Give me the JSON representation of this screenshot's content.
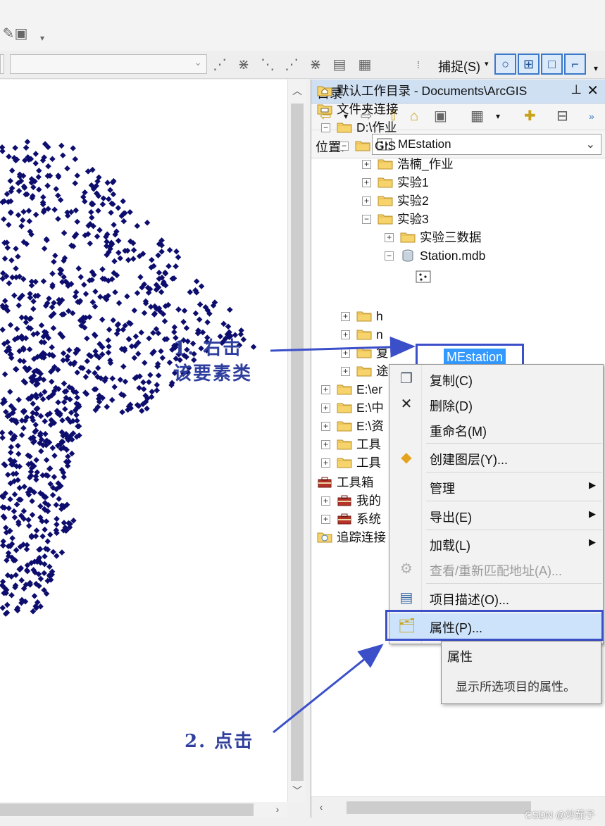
{
  "toolbar": {
    "snap_label": "捕捉(S)",
    "snap_buttons": [
      "point-snap",
      "vertex-snap",
      "edge-snap",
      "end-snap"
    ]
  },
  "catalog": {
    "title": "目录",
    "location_label": "位置:",
    "location_value": "MEstation",
    "tree": [
      {
        "label": "默认工作目录 - Documents\\ArcGIS",
        "icon": "home-folder-icon"
      },
      {
        "label": "文件夹连接",
        "icon": "folder-connections-icon"
      },
      {
        "label": "D:\\作业",
        "icon": "folder-icon"
      },
      {
        "label": "GIS",
        "icon": "folder-icon"
      },
      {
        "label": "浩楠_作业",
        "icon": "folder-icon"
      },
      {
        "label": "实验1",
        "icon": "folder-icon"
      },
      {
        "label": "实验2",
        "icon": "folder-icon"
      },
      {
        "label": "实验3",
        "icon": "folder-icon"
      },
      {
        "label": "实验三数据",
        "icon": "folder-icon"
      },
      {
        "label": "Station.mdb",
        "icon": "database-icon"
      },
      {
        "label": "MEstation",
        "icon": "point-feature-class-icon"
      },
      {
        "label": "h",
        "icon": "folder-icon"
      },
      {
        "label": "n",
        "icon": "folder-icon"
      },
      {
        "label": "复",
        "icon": "folder-icon"
      },
      {
        "label": "途",
        "icon": "folder-icon"
      },
      {
        "label": "E:\\er",
        "icon": "folder-icon"
      },
      {
        "label": "E:\\中",
        "icon": "folder-icon"
      },
      {
        "label": "E:\\资",
        "icon": "folder-icon"
      },
      {
        "label": "工具",
        "icon": "folder-icon"
      },
      {
        "label": "工具",
        "icon": "folder-icon"
      },
      {
        "label": "工具箱",
        "icon": "toolbox-icon"
      },
      {
        "label": "我的",
        "icon": "toolbox-icon"
      },
      {
        "label": "系统",
        "icon": "toolbox-icon"
      },
      {
        "label": "追踪连接",
        "icon": "tracking-icon"
      }
    ]
  },
  "context_menu": {
    "copy": "复制(C)",
    "delete": "删除(D)",
    "rename": "重命名(M)",
    "create_layer": "创建图层(Y)...",
    "manage": "管理",
    "export": "导出(E)",
    "load": "加载(L)",
    "geocode": "查看/重新匹配地址(A)...",
    "item_description": "项目描述(O)...",
    "properties": "属性(P)..."
  },
  "tooltip": {
    "title": "属性",
    "description": "显示所选项目的属性。"
  },
  "annotations": {
    "step1_line1": "1. 右击",
    "step1_line2": "该要素类",
    "step2": "2. 点击"
  },
  "watermark": "CSDN @炒茄子",
  "colors": {
    "accent": "#3b4fc9",
    "selection": "#3399ff",
    "points": "#0d0d6e",
    "menu_highlight": "#cce3fb"
  }
}
